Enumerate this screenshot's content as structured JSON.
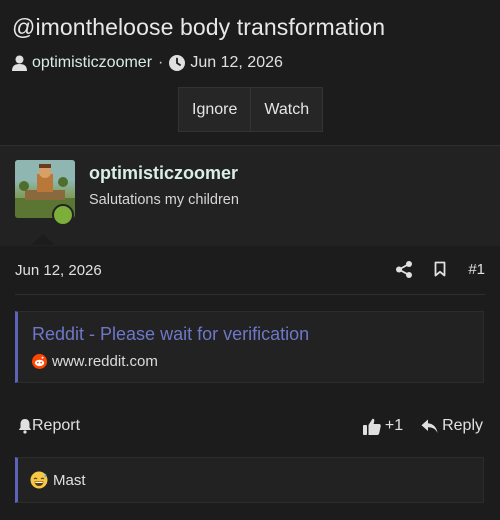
{
  "thread": {
    "title": "@imontheloose body transformation",
    "author": "optimisticzoomer",
    "date": "Jun 12, 2026",
    "separator": "·",
    "buttons": {
      "ignore": "Ignore",
      "watch": "Watch"
    }
  },
  "post": {
    "username": "optimisticzoomer",
    "user_title": "Salutations my children",
    "date": "Jun 12, 2026",
    "number": "#1",
    "link_preview": {
      "title": "Reddit - Please wait for verification",
      "domain": "www.reddit.com"
    },
    "report_label": "Report",
    "reaction_count": "+1",
    "reply_label": "Reply"
  },
  "next_post": {
    "text": "Mast"
  },
  "colors": {
    "background": "#1c1c1c",
    "panel": "#222222",
    "accent_link": "#6f77c9",
    "quote_bar": "#5c63b8",
    "online": "#7cae3a"
  },
  "icons": [
    "user-icon",
    "clock-icon",
    "share-icon",
    "bookmark-icon",
    "bell-icon",
    "thumbs-up-icon",
    "reply-icon",
    "reddit-favicon",
    "grinning-sweat-emoji"
  ]
}
